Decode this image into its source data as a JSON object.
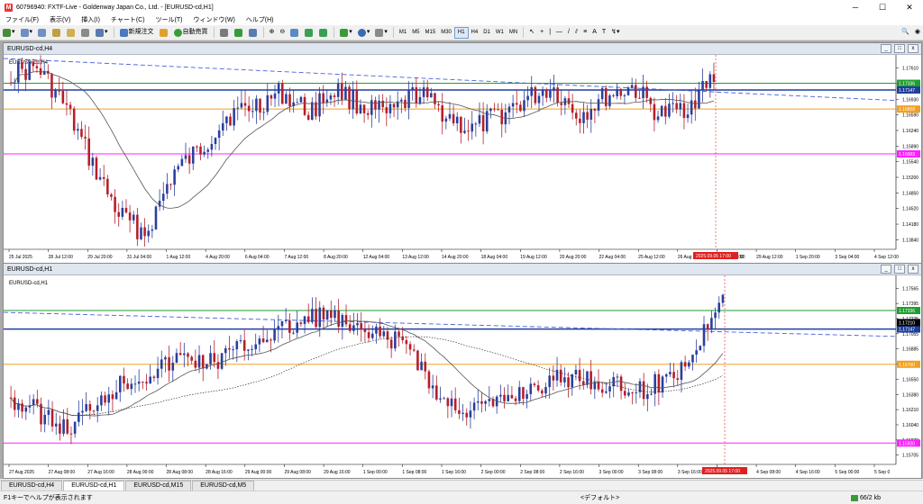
{
  "window": {
    "title": "60796940: FXTF-Live - Goldenway Japan Co., Ltd. - [EURUSD-cd,H1]"
  },
  "menu": [
    "ファイル(F)",
    "表示(V)",
    "挿入(I)",
    "チャート(C)",
    "ツール(T)",
    "ウィンドウ(W)",
    "ヘルプ(H)"
  ],
  "toolbar": {
    "new_order": "新規注文",
    "auto_trading": "自動売買",
    "timeframes": [
      "M1",
      "M5",
      "M15",
      "M30",
      "H1",
      "H4",
      "D1",
      "W1",
      "MN"
    ],
    "active_timeframe": "H1"
  },
  "chart_top": {
    "window_title": "EURUSD-cd,H4",
    "symbol_label": "EURUSD-cd,H4",
    "price_ticks": [
      "1.17610",
      "1.17280",
      "1.16930",
      "1.16590",
      "1.16240",
      "1.15890",
      "1.15540",
      "1.15200",
      "1.14850",
      "1.14520",
      "1.14180",
      "1.13840"
    ],
    "price_tags": {
      "green": "1.17336",
      "current": "1.17147",
      "orange": "1.16858",
      "magenta": "1.16003"
    },
    "time_ticks": [
      "25 Jul 2025",
      "28 Jul 12:00",
      "29 Jul 20:00",
      "31 Jul 04:00",
      "1 Aug 12:00",
      "4 Aug 20:00",
      "6 Aug 04:00",
      "7 Aug 12:00",
      "8 Aug 20:00",
      "12 Aug 04:00",
      "13 Aug 12:00",
      "14 Aug 20:00",
      "18 Aug 04:00",
      "19 Aug 12:00",
      "20 Aug 20:00",
      "22 Aug 04:00",
      "25 Aug 12:00",
      "26 Aug 20:00",
      "28 Aug 04:00",
      "29 Aug 12:00",
      "1 Sep 20:00",
      "3 Sep 04:00",
      "4 Sep 12:00"
    ],
    "cursor_time": "2025.09.05 17:00",
    "time_tail": "00"
  },
  "chart_bottom": {
    "window_title": "EURUSD-cd,H1",
    "symbol_label": "EURUSD-cd,H1",
    "price_ticks": [
      "1.17565",
      "1.17395",
      "1.17225",
      "1.17055",
      "1.16885",
      "1.16720",
      "1.16550",
      "1.16380",
      "1.16210",
      "1.16040",
      "1.15870",
      "1.15705"
    ],
    "price_tags": {
      "green": "1.17336",
      "current": "1.17210",
      "blue": "1.17147",
      "orange": "1.16760",
      "magenta": "1.15920"
    },
    "time_ticks": [
      "27 Aug 2025",
      "27 Aug 08:00",
      "27 Aug 16:00",
      "28 Aug 00:00",
      "28 Aug 08:00",
      "28 Aug 16:00",
      "29 Aug 00:00",
      "29 Aug 08:00",
      "29 Aug 16:00",
      "1 Sep 00:00",
      "1 Sep 08:00",
      "1 Sep 16:00",
      "2 Sep 00:00",
      "2 Sep 08:00",
      "2 Sep 16:00",
      "3 Sep 00:00",
      "3 Sep 08:00",
      "3 Sep 16:00",
      "4 Sep 00:00",
      "4 Sep 08:00",
      "4 Sep 16:00",
      "5 Sep 00:00",
      "5 Sep 0"
    ],
    "cursor_time": "2025.09.05 17:00"
  },
  "tabs": [
    "EURUSD-cd,H4",
    "EURUSD-cd,H1",
    "EURUSD-cd,M15",
    "EURUSD-cd,M5"
  ],
  "active_tab": "EURUSD-cd,H1",
  "status": {
    "help": "F1キーでヘルプが表示されます",
    "profile": "<デフォルト>",
    "traffic": "66/2 kb"
  },
  "colors": {
    "bull": "#2a3f9e",
    "bear": "#b51e2a",
    "green_line": "#1f9e2f",
    "blue_line": "#1f3f9e",
    "orange_line": "#f0a020",
    "magenta_line": "#ff20ff",
    "trend_dash": "#4a5fd8",
    "ma": "#555555",
    "cursor": "#e02020"
  }
}
